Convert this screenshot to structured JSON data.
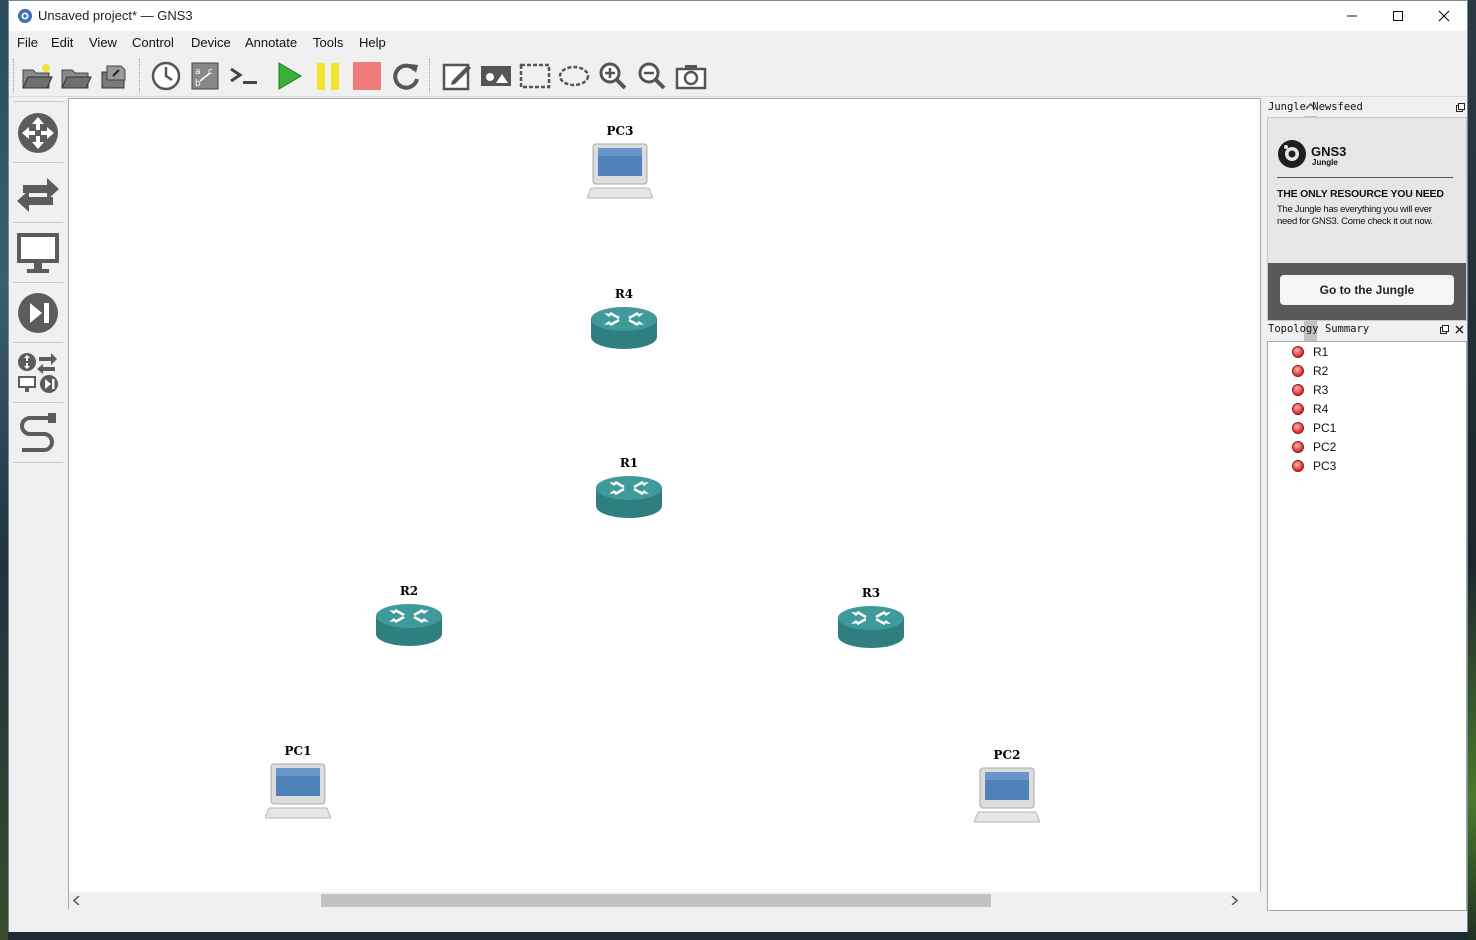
{
  "window": {
    "title": "Unsaved project* — GNS3"
  },
  "menu": [
    "File",
    "Edit",
    "View",
    "Control",
    "Device",
    "Annotate",
    "Tools",
    "Help"
  ],
  "toolbar": {
    "icons": [
      "new-project-icon",
      "open-project-icon",
      "save-project-icon",
      "snapshot-icon",
      "show-interface-labels-icon",
      "console-all-icon",
      "start-all-icon",
      "suspend-all-icon",
      "stop-all-icon",
      "reload-all-icon",
      "add-note-icon",
      "insert-picture-icon",
      "draw-rectangle-icon",
      "draw-ellipse-icon",
      "zoom-in-icon",
      "zoom-out-icon",
      "screenshot-icon"
    ]
  },
  "canvas": {
    "nodes": [
      {
        "label": "PC3",
        "kind": "pc"
      },
      {
        "label": "R4",
        "kind": "router"
      },
      {
        "label": "R1",
        "kind": "router"
      },
      {
        "label": "R2",
        "kind": "router"
      },
      {
        "label": "R3",
        "kind": "router"
      },
      {
        "label": "PC1",
        "kind": "pc"
      },
      {
        "label": "PC2",
        "kind": "pc"
      }
    ]
  },
  "newsfeed": {
    "title": "Jungle Newsfeed",
    "brand": "GNS3",
    "brand_sub": "Jungle",
    "headline": "THE ONLY RESOURCE YOU NEED",
    "body": "The Jungle has everything you will ever need for GNS3. Come check it out now.",
    "button": "Go to the Jungle"
  },
  "topology": {
    "title": "Topology Summary",
    "items": [
      "R1",
      "R2",
      "R3",
      "R4",
      "PC1",
      "PC2",
      "PC3"
    ],
    "status_color": "#e23a3a"
  }
}
